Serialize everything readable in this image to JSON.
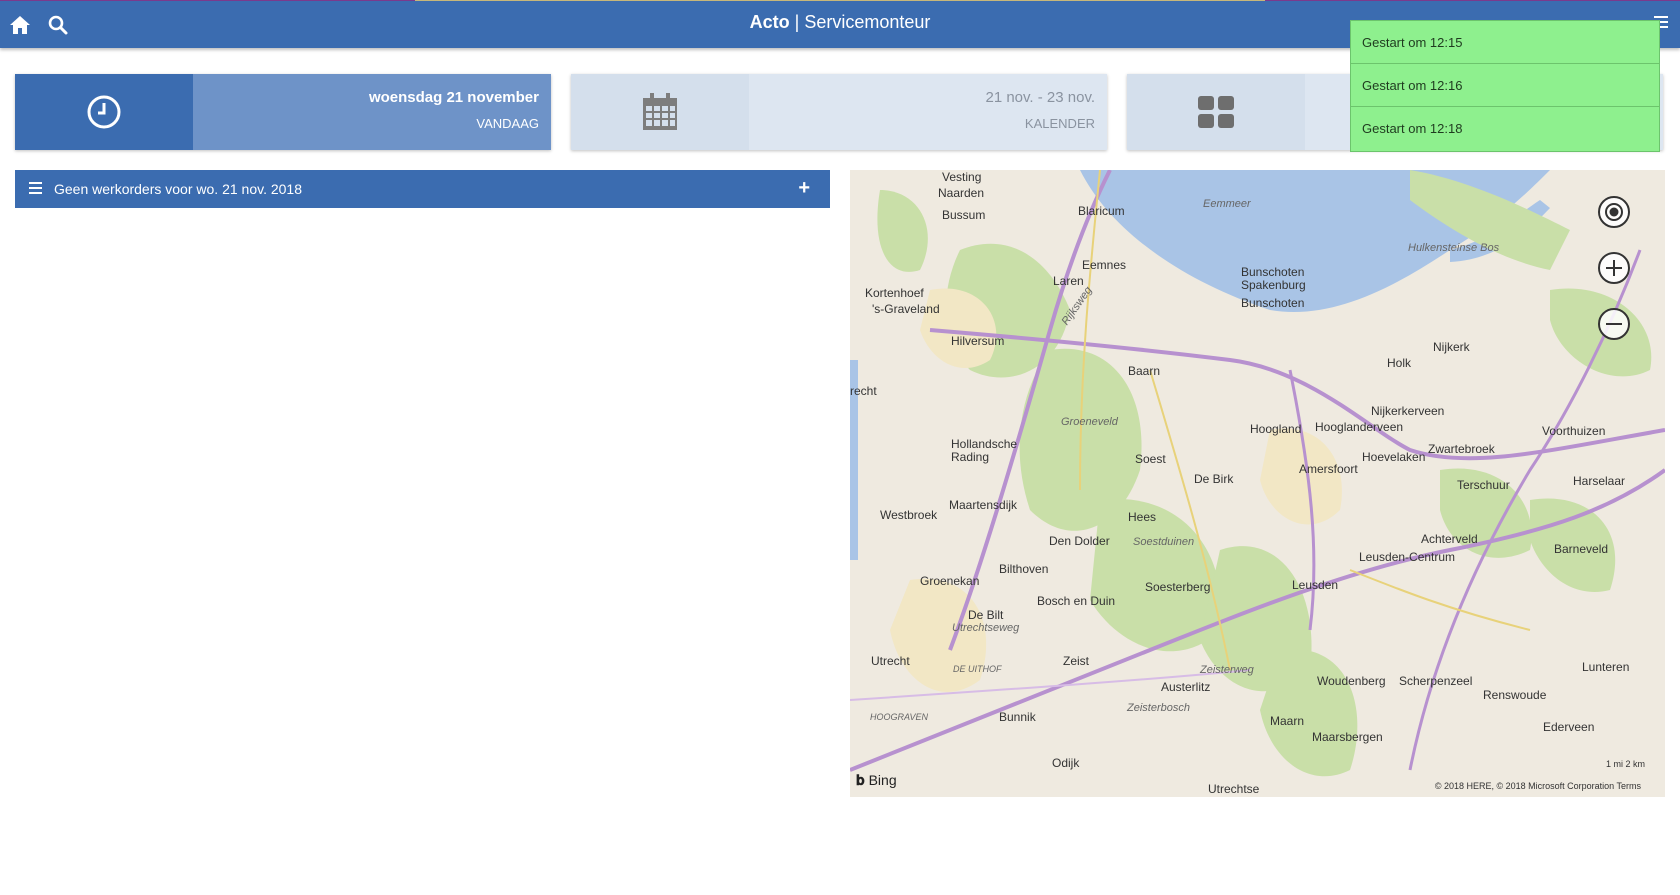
{
  "header": {
    "brand": "Acto",
    "separator": "|",
    "subtitle": "Servicemonteur",
    "icons": [
      "home-icon",
      "search-icon",
      "menu-icon"
    ],
    "color": "#3b6cb0"
  },
  "tiles": [
    {
      "line1": "woensdag 21 november",
      "line2": "VANDAAG",
      "icon": "clock-icon"
    },
    {
      "line1": "21 nov. - 23 nov.",
      "line2": "KALENDER",
      "icon": "calendar-icon"
    },
    {
      "line1": "",
      "line2": "",
      "icon": "grid-icon"
    }
  ],
  "notifications": [
    {
      "text": "Gestart om 12:15"
    },
    {
      "text": "Gestart om 12:16"
    },
    {
      "text": "Gestart om 12:18"
    }
  ],
  "workorders": {
    "message": "Geen werkorders voor wo. 21 nov. 2018",
    "add_label": "+"
  },
  "map": {
    "labels": {
      "vesting": "Vesting",
      "naarden": "Naarden",
      "bussum": "Bussum",
      "blaricum": "Blaricum",
      "eemmeer": "Eemmeer",
      "hulkensteinse": "Hulkensteinse Bos",
      "laren": "Laren",
      "eemnes": "Eemnes",
      "bunschoten_sp": "Bunschoten Spakenburg",
      "bunschoten": "Bunschoten",
      "kortenhoef": "Kortenhoef",
      "graveland": "'s-Graveland",
      "hilversum": "Hilversum",
      "baarn": "Baarn",
      "nijkerk": "Nijkerk",
      "holk": "Holk",
      "recht": "recht",
      "groeneveld": "Groeneveld",
      "nijkerkerveen": "Nijkerkerveen",
      "hoogland": "Hoogland",
      "hooglanderveen": "Hooglanderveen",
      "voorthuizen": "Voorthuizen",
      "hollandsche": "Hollandsche Rading",
      "soest": "Soest",
      "de_birk": "De Birk",
      "amersfoort": "Amersfoort",
      "hoevelaken": "Hoevelaken",
      "zwartebroek": "Zwartebroek",
      "terschuur": "Terschuur",
      "harselaar": "Harselaar",
      "maartensdijk": "Maartensdijk",
      "westbroek": "Westbroek",
      "hees": "Hees",
      "den_dolder": "Den Dolder",
      "soestduinen": "Soestduinen",
      "achterveld": "Achterveld",
      "leusden_c": "Leusden-Centrum",
      "barneveld": "Barneveld",
      "bilthoven": "Bilthoven",
      "groenekan": "Groenekan",
      "soesterberg": "Soesterberg",
      "leusden": "Leusden",
      "de_bilt": "De Bilt",
      "bosch_en_duin": "Bosch en Duin",
      "utrecht": "Utrecht",
      "zeist": "Zeist",
      "austerlitz": "Austerlitz",
      "woudenberg": "Woudenberg",
      "scherpenzeel": "Scherpenzeel",
      "lunteren": "Lunteren",
      "renswoude": "Renswoude",
      "de_uithof": "DE UITHOF",
      "zeisterbosch": "Zeisterbosch",
      "bunnik": "Bunnik",
      "maarn": "Maarn",
      "maarsbergen": "Maarsbergen",
      "ederveen": "Ederveen",
      "hoograven": "HOOGRAVEN",
      "odijk": "Odijk",
      "utrechtse": "Utrechtse",
      "utrechtseweg": "Utrechtseweg",
      "rijksweg": "Rijksweg",
      "zeisterweg": "Zeisterweg"
    },
    "bing": "Bing",
    "copyright": "© 2018 HERE, © 2018 Microsoft Corporation  Terms",
    "scale": "1 mi   2 km",
    "controls": [
      "locate-icon",
      "zoom-in-icon",
      "zoom-out-icon"
    ]
  }
}
